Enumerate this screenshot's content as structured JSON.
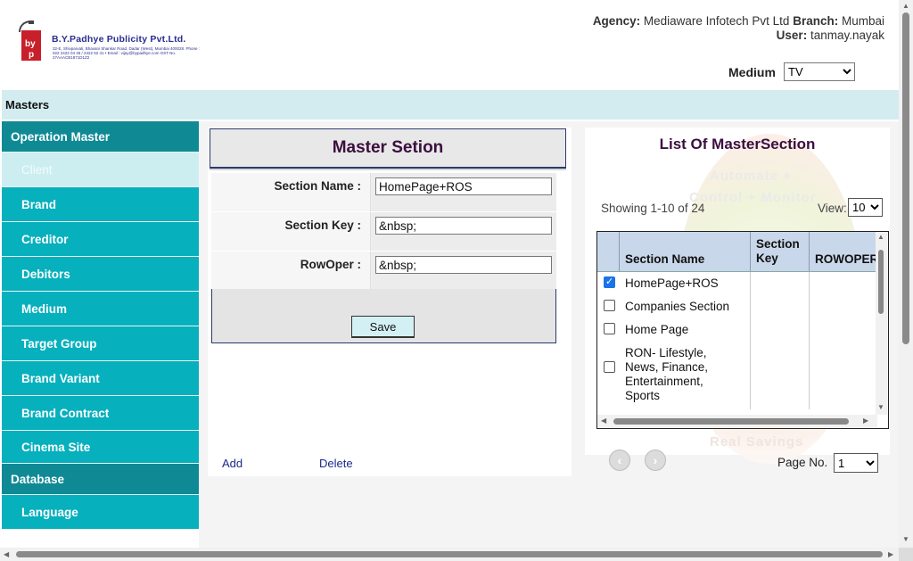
{
  "header": {
    "company_name": "B.Y.Padhye Publicity Pvt.Ltd.",
    "company_address": "32-E, Shivparvati, Bhavani Shankar Road, Dadar (West), Mumbai 400028. Phone : 022 2422 04 45 / 2422 52 41 • Email : vijay@bypadhye.com GST No. 27AAACB1871D1Z2",
    "agency_label": "Agency:",
    "agency_value": "Mediaware Infotech Pvt Ltd",
    "branch_label": "Branch:",
    "branch_value": "Mumbai",
    "user_label": "User:",
    "user_value": "tanmay.nayak",
    "medium_label": "Medium",
    "medium_value": "TV"
  },
  "masters_bar": {
    "label": "Masters"
  },
  "sidebar": {
    "sections": [
      {
        "label": "Operation Master"
      },
      {
        "label": "Database"
      }
    ],
    "items": [
      {
        "label": "Client"
      },
      {
        "label": "Brand"
      },
      {
        "label": "Creditor"
      },
      {
        "label": "Debitors"
      },
      {
        "label": "Medium"
      },
      {
        "label": "Target Group"
      },
      {
        "label": "Brand Variant"
      },
      {
        "label": "Brand Contract"
      },
      {
        "label": "Cinema Site"
      },
      {
        "label": "Language"
      }
    ]
  },
  "form": {
    "title": "Master Setion",
    "fields": [
      {
        "label": "Section Name :",
        "value": "HomePage+ROS"
      },
      {
        "label": "Section Key :",
        "value": "&nbsp;"
      },
      {
        "label": "RowOper :",
        "value": "&nbsp;"
      }
    ],
    "save_label": "Save",
    "add_label": "Add",
    "delete_label": "Delete"
  },
  "list": {
    "title": "List Of MasterSection",
    "watermark_lines": [
      "Automate +",
      "Control + Monitor",
      "Real Savings"
    ],
    "showing": "Showing 1-10 of 24",
    "view_label": "View:",
    "view_value": "10",
    "columns": [
      "Section Name",
      "Section Key",
      "ROWOPER"
    ],
    "rows": [
      {
        "name": "HomePage+ROS",
        "checked": true
      },
      {
        "name": "Companies Section",
        "checked": false
      },
      {
        "name": "Home Page",
        "checked": false
      },
      {
        "name": "RON- Lifestyle, News, Finance, Entertainment, Sports",
        "checked": false
      }
    ],
    "page_label": "Page No.",
    "page_value": "1"
  },
  "icons": {
    "prev": "prev-arrow-icon",
    "next": "next-arrow-icon",
    "check": "checkmark-icon"
  }
}
